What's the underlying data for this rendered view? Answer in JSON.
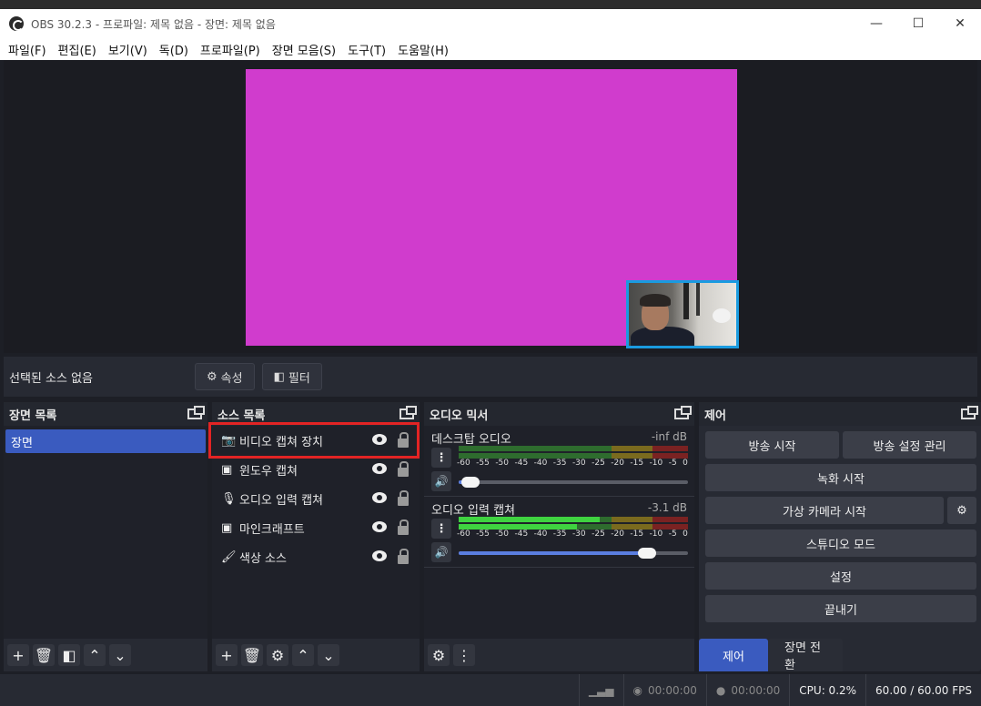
{
  "window": {
    "title": "OBS 30.2.3 - 프로파일: 제목 없음 - 장면: 제목 없음",
    "minimize": "—",
    "maximize": "☐",
    "close": "✕"
  },
  "menu": [
    "파일(F)",
    "편집(E)",
    "보기(V)",
    "독(D)",
    "프로파일(P)",
    "장면 모음(S)",
    "도구(T)",
    "도움말(H)"
  ],
  "preview": {
    "canvas_color": "#d03ccd",
    "webcam_border": "#1a9be0"
  },
  "source_toolbar": {
    "no_selection": "선택된 소스 없음",
    "properties": "속성",
    "filters": "필터"
  },
  "scenes": {
    "title": "장면 목록",
    "items": [
      "장면"
    ]
  },
  "sources": {
    "title": "소스 목록",
    "items": [
      {
        "icon": "camera-icon",
        "label": "비디오 캡쳐 장치"
      },
      {
        "icon": "window-icon",
        "label": "윈도우 캡쳐"
      },
      {
        "icon": "microphone-icon",
        "label": "오디오 입력 캡쳐"
      },
      {
        "icon": "window-icon",
        "label": "마인크래프트"
      },
      {
        "icon": "brush-icon",
        "label": "색상 소스"
      }
    ]
  },
  "audio": {
    "title": "오디오 믹서",
    "scale": [
      "-60",
      "-55",
      "-50",
      "-45",
      "-40",
      "-35",
      "-30",
      "-25",
      "-20",
      "-15",
      "-10",
      "-5",
      "0"
    ],
    "channels": [
      {
        "name": "데스크탑 오디오",
        "db": "-inf dB",
        "volume": 0.05
      },
      {
        "name": "오디오 입력 캡쳐",
        "db": "-3.1 dB",
        "volume": 0.82
      }
    ]
  },
  "controls": {
    "title": "제어",
    "start_stream": "방송 시작",
    "stream_settings": "방송 설정 관리",
    "start_record": "녹화 시작",
    "virtual_cam": "가상 카메라 시작",
    "studio_mode": "스튜디오 모드",
    "settings": "설정",
    "exit": "끝내기",
    "tab_controls": "제어",
    "tab_transitions": "장면 전환"
  },
  "status": {
    "stream_time": "00:00:00",
    "record_time": "00:00:00",
    "cpu": "CPU: 0.2%",
    "fps": "60.00 / 60.00 FPS"
  },
  "colors": {
    "accent": "#3a5bbf",
    "highlight": "#e22424"
  }
}
